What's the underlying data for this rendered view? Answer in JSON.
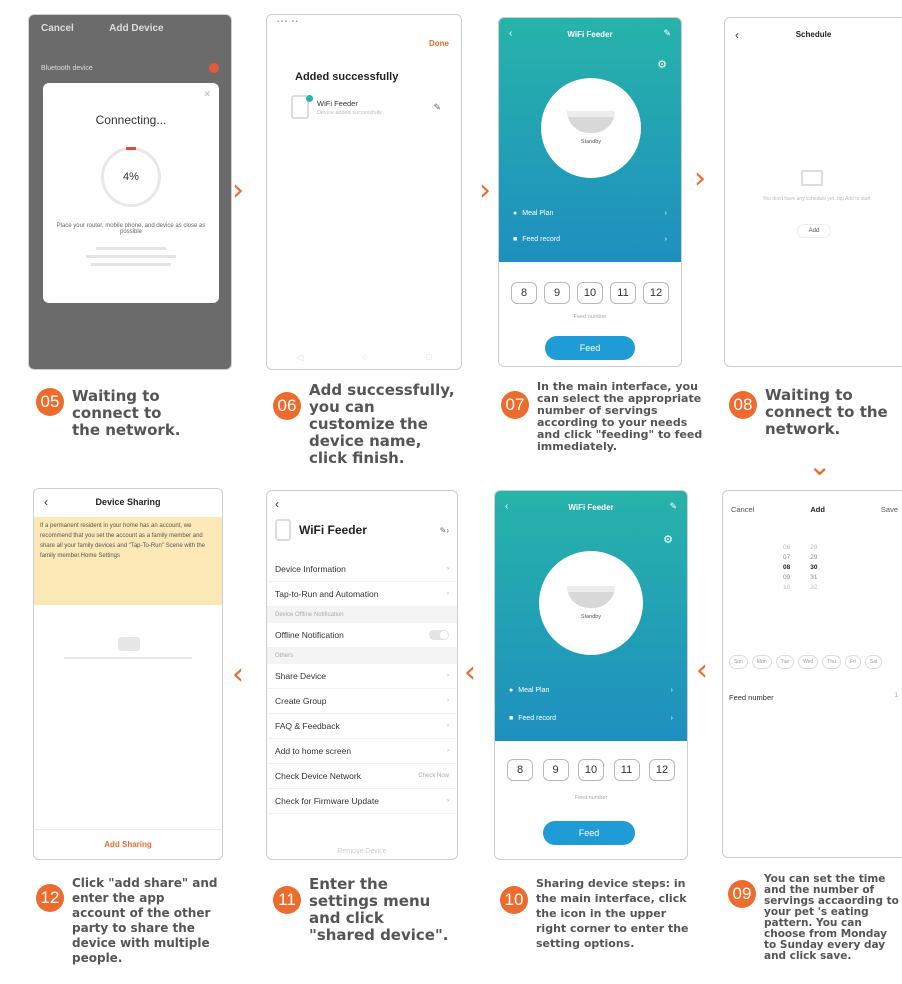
{
  "steps": {
    "s05": {
      "num": "05",
      "caption": "Waiting to connect to the network."
    },
    "s06": {
      "num": "06",
      "caption": "Add successfully, you can customize the device name, click finish."
    },
    "s07": {
      "num": "07",
      "caption": "In the main interface, you can select the appropriate number of servings according to your needs and click \"feeding\" to feed immediately."
    },
    "s08": {
      "num": "08",
      "caption": "Waiting to connect to the network."
    },
    "s09": {
      "num": "09",
      "caption": "You can set the time and the number of servings accaording to your pet 's eating pattern. You can choose from Monday to Sunday every day and click save."
    },
    "s10": {
      "num": "10",
      "caption": "Sharing device steps: in the main interface, click the icon in the upper right corner to enter the setting options."
    },
    "s11": {
      "num": "11",
      "caption": "Enter the settings menu and click \"shared device\"."
    },
    "s12": {
      "num": "12",
      "caption": "Click \"add share\" and enter the app account of the other party to share the device with multiple people."
    }
  },
  "arrows": {
    "right": "›",
    "left": "‹",
    "down": "⌄"
  },
  "screen05": {
    "cancel": "Cancel",
    "title": "Add Device",
    "bluetooth": "Bluetooth device",
    "connecting": "Connecting...",
    "percent": "4%",
    "hint": "Place your router, mobile phone, and device as close as possible"
  },
  "screen06": {
    "done": "Done",
    "heading": "Added successfully",
    "device": "WiFi Feeder",
    "sub": "Device added successfully"
  },
  "feeder": {
    "title": "WiFi Feeder",
    "status": "Standby",
    "meal_plan": "Meal Plan",
    "feed_record": "Feed record",
    "numbers": [
      "8",
      "9",
      "10",
      "11",
      "12"
    ],
    "feed_number": "Feed number",
    "feed": "Feed"
  },
  "screen08": {
    "title": "Schedule",
    "empty": "You don't have any schedule yet, tap Add to start",
    "add": "Add"
  },
  "screen09": {
    "cancel": "Cancel",
    "title": "Add",
    "save": "Save",
    "hours": [
      "06",
      "07",
      "08",
      "09",
      "10"
    ],
    "minutes": [
      "28",
      "29",
      "30",
      "31",
      "32"
    ],
    "days": [
      "Sun",
      "Mon",
      "Tue",
      "Wed",
      "Thu",
      "Fri",
      "Sat"
    ],
    "feed_number": "Feed number",
    "feed_value": "1"
  },
  "screen11": {
    "title": "WiFi Feeder",
    "items_top": [
      "Device Information",
      "Tap-to-Run and Automation"
    ],
    "offline_header": "Device Offline Notification",
    "offline": "Offline Notification",
    "others_header": "Others",
    "items_bottom": [
      "Share Device",
      "Create Group",
      "FAQ & Feedback",
      "Add to home screen",
      "Check Device Network",
      "Check for Firmware Update"
    ],
    "check_now": "Check Now",
    "remove": "Remove Device"
  },
  "screen12": {
    "title": "Device Sharing",
    "notice": "If a permanent resident in your home has an account, we recommend that you set the account as a family member and share all your family devices and \"Tap-To-Run\" Scene with the family member.Home Settings",
    "add_sharing": "Add Sharing"
  }
}
